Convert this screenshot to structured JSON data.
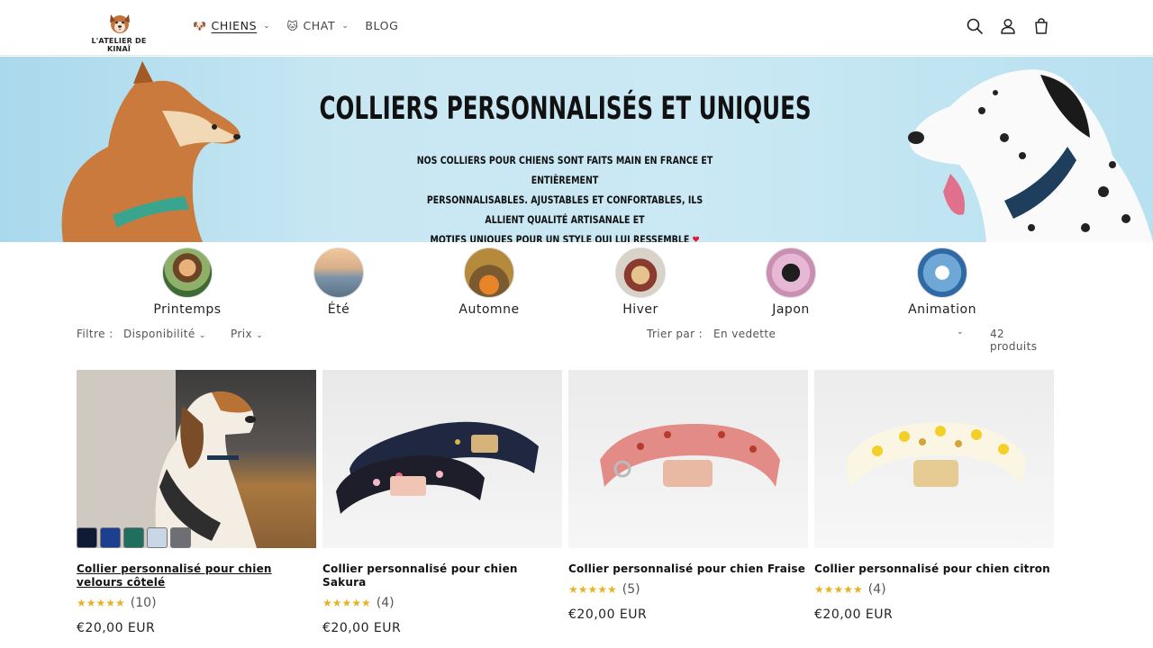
{
  "header": {
    "logo_text": "L'ATELIER DE KINAÏ",
    "nav": [
      {
        "emoji": "🐶",
        "label": "CHIENS",
        "dropdown": true
      },
      {
        "emoji": "🐱",
        "label": "CHAT",
        "dropdown": true
      },
      {
        "emoji": "",
        "label": "BLOG",
        "dropdown": false
      }
    ],
    "icons": [
      "search-icon",
      "account-icon",
      "cart-icon"
    ]
  },
  "banner": {
    "title": "COLLIERS PERSONNALISÉS ET UNIQUES",
    "line1": "NOS COLLIERS POUR CHIENS SONT FAITS MAIN EN FRANCE ET ENTIÈREMENT",
    "line2": "PERSONNALISABLES. AJUSTABLES ET CONFORTABLES, ILS ALLIENT QUALITÉ ARTISANALE ET",
    "line3": "MOTIFS UNIQUES POUR UN STYLE QUI LUI RESSEMBLE",
    "heart": "❤"
  },
  "categories": [
    {
      "label": "Printemps"
    },
    {
      "label": "Été"
    },
    {
      "label": "Automne"
    },
    {
      "label": "Hiver"
    },
    {
      "label": "Japon"
    },
    {
      "label": "Animation"
    }
  ],
  "filters": {
    "filter_label": "Filtre :",
    "availability": "Disponibilité",
    "price": "Prix",
    "sort_label": "Trier par :",
    "sort_value": "En vedette",
    "count": "42 produits"
  },
  "products": [
    {
      "title": "Collier personnalisé pour chien velours côtelé",
      "stars": "★★★★★",
      "reviews": "(10)",
      "price": "€20,00 EUR"
    },
    {
      "title": "Collier personnalisé pour chien Sakura",
      "stars": "★★★★★",
      "reviews": "(4)",
      "price": "€20,00 EUR"
    },
    {
      "title": "Collier personnalisé pour chien Fraise",
      "stars": "★★★★★",
      "reviews": "(5)",
      "price": "€20,00 EUR"
    },
    {
      "title": "Collier personnalisé pour chien citron",
      "stars": "★★★★★",
      "reviews": "(4)",
      "price": "€20,00 EUR"
    }
  ],
  "swatch_colors": [
    "#0f1a35",
    "#1c3f8f",
    "#1f6e5e",
    "#c9d6e6",
    "#6d6f74"
  ],
  "colors": {
    "star": "#e6b325",
    "banner_bg": "#c8e7f3",
    "heart": "#d81b2b"
  }
}
